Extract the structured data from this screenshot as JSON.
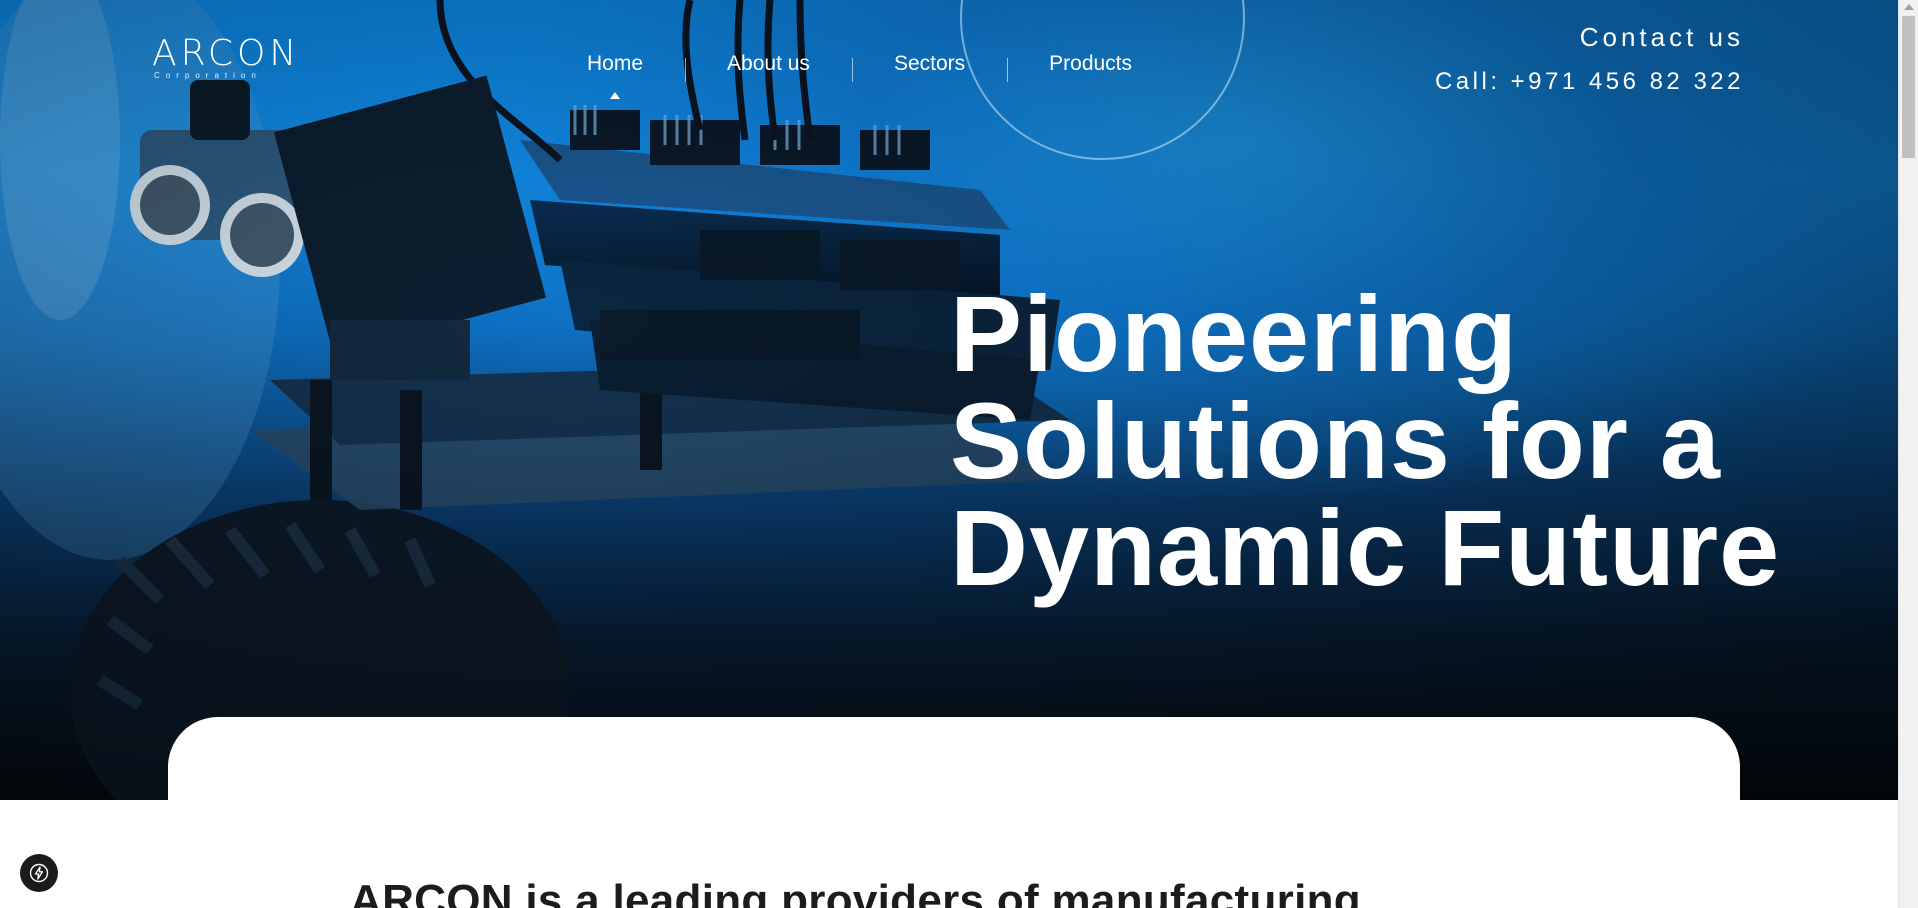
{
  "brand": {
    "logo_text": "ARCON",
    "logo_subtext": "Corporation"
  },
  "nav": {
    "items": [
      {
        "label": "Home",
        "active": true
      },
      {
        "label": "About us",
        "active": false
      },
      {
        "label": "Sectors",
        "active": false
      },
      {
        "label": "Products",
        "active": false
      }
    ]
  },
  "contact": {
    "link_label": "Contact us",
    "phone": "Call: +971 456 82 322"
  },
  "hero": {
    "title_line1": "Pioneering",
    "title_line2": "Solutions for a",
    "title_line3": "Dynamic Future"
  },
  "intro": {
    "heading": "ARCON is a leading providers of manufacturing"
  },
  "widgets": {
    "bolt_icon": "lightning-bolt-icon"
  },
  "colors": {
    "hero_blue": "#1290ef",
    "hero_dark": "#050a10",
    "text_white": "#ffffff",
    "heading_dark": "#1c1c1c"
  }
}
